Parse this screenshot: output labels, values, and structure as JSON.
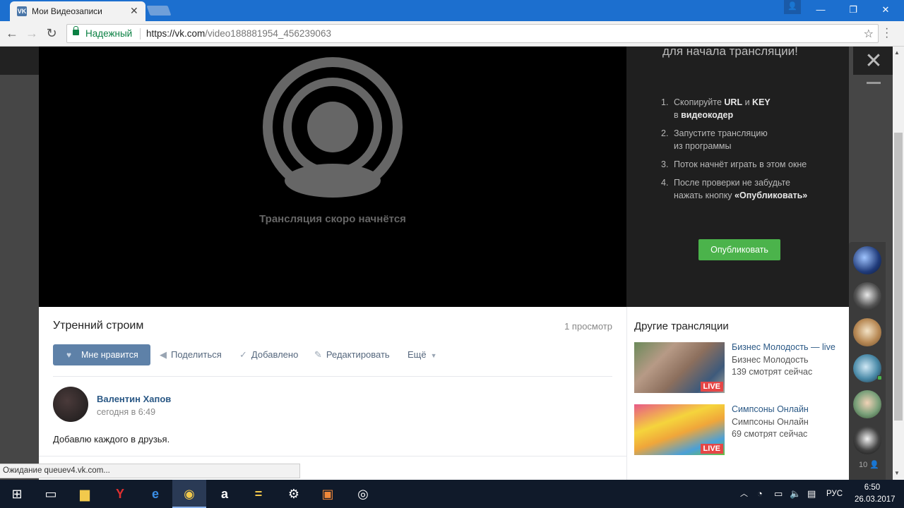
{
  "browser": {
    "tab_title": "Мои Видеозаписи",
    "tab_favicon": "VK",
    "secure_label": "Надежный",
    "url_host": "https://vk.com",
    "url_path": "/video188881954_456239063"
  },
  "player": {
    "status_text": "Трансляция скоро начнётся",
    "start_title": "для начала трансляции!",
    "steps": [
      {
        "num": "1.",
        "pre": "Скопируйте ",
        "b1": "URL",
        "mid": " и ",
        "b2": "KEY",
        "line2pre": "в ",
        "line2b": "видеокодер"
      },
      {
        "num": "2.",
        "text": "Запустите трансляцию",
        "text2": "из программы"
      },
      {
        "num": "3.",
        "text": "Поток начнёт играть в этом окне"
      },
      {
        "num": "4.",
        "text": "После проверки не забудьте",
        "text2pre": "нажать кнопку ",
        "text2b": "«Опубликовать»"
      }
    ],
    "publish_button": "Опубликовать"
  },
  "video": {
    "title": "Утренний строим",
    "views": "1 просмотр",
    "like_label": "Мне нравится",
    "share_label": "Поделиться",
    "added_label": "Добавлено",
    "edit_label": "Редактировать",
    "more_label": "Ещё"
  },
  "comment": {
    "author": "Валентин Хапов",
    "date": "сегодня в 6:49",
    "text": "Добавлю каждого в друзья."
  },
  "status_bar": "Ожидание queuev4.vk.com...",
  "others": {
    "title": "Другие трансляции",
    "items": [
      {
        "title": "Бизнес Молодость — live",
        "author": "Бизнес Молодость",
        "watching": "139 смотрят сейчас",
        "badge": "LIVE"
      },
      {
        "title": "Симпсоны Онлайн",
        "author": "Симпсоны Онлайн",
        "watching": "69 смотрят сейчас",
        "badge": "LIVE"
      }
    ]
  },
  "friends": {
    "count": "10"
  },
  "taskbar": {
    "lang": "РУС",
    "time": "6:50",
    "date": "26.03.2017"
  },
  "colors": {
    "vk_blue": "#5e81a8",
    "publish_green": "#4bb34b",
    "live_red": "#e64646",
    "titlebar": "#1c6fcf"
  }
}
